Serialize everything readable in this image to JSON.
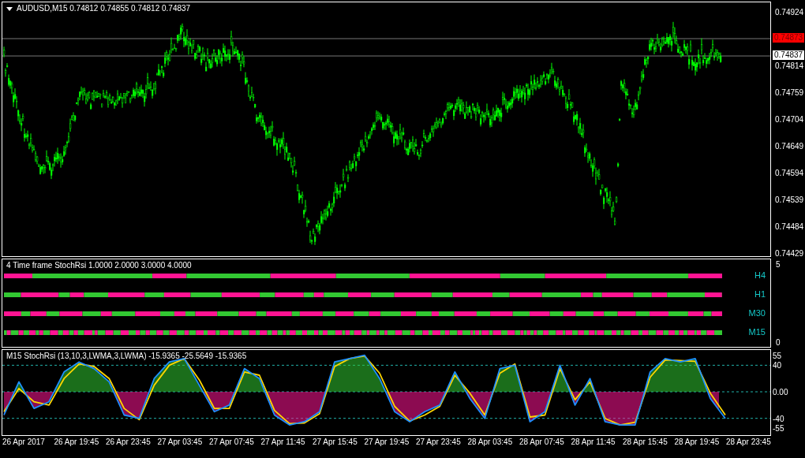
{
  "main_chart": {
    "title": "AUDUSD,M15  0.74812 0.74855 0.74812 0.74837",
    "price_axis": [
      {
        "kind": "tick",
        "label": "0.74924"
      },
      {
        "kind": "ask",
        "label": "0.74873"
      },
      {
        "kind": "bid",
        "label": "0.74837"
      },
      {
        "kind": "tick",
        "label": "0.74814"
      },
      {
        "kind": "tick",
        "label": "0.74759"
      },
      {
        "kind": "tick",
        "label": "0.74704"
      },
      {
        "kind": "tick",
        "label": "0.74649"
      },
      {
        "kind": "tick",
        "label": "0.74594"
      },
      {
        "kind": "tick",
        "label": "0.74539"
      },
      {
        "kind": "tick",
        "label": "0.74484"
      },
      {
        "kind": "tick",
        "label": "0.74429"
      }
    ]
  },
  "timeframe_panel": {
    "title": "4 Time frame StochRsi 1.0000 2.0000 3.0000 4.0000",
    "rows": [
      {
        "label": "H4"
      },
      {
        "label": "H1"
      },
      {
        "label": "M30"
      },
      {
        "label": "M15"
      }
    ],
    "axis": [
      "5",
      "0"
    ]
  },
  "oscillator_panel": {
    "title": "M15  StochRsi (13,10,3,LWMA,3,LWMA) -15.9365 -25.5649 -15.9365",
    "chart_data": {
      "type": "line",
      "ylim": [
        -66.5,
        63
      ],
      "grid": true,
      "yticks": [
        {
          "value": 55,
          "label": "55"
        },
        {
          "value": 40,
          "label": "40"
        },
        {
          "value": 0,
          "label": "0.00"
        },
        {
          "value": -40,
          "label": "-40"
        },
        {
          "value": -55,
          "label": "-55"
        }
      ],
      "series": [
        {
          "color": "#1e90ff",
          "values": [
            -35,
            15,
            -25,
            -15,
            30,
            45,
            35,
            15,
            -35,
            -40,
            20,
            45,
            50,
            10,
            -30,
            -20,
            35,
            20,
            -35,
            -50,
            -45,
            -30,
            45,
            50,
            55,
            20,
            -30,
            -45,
            -30,
            -20,
            30,
            -10,
            -40,
            35,
            40,
            -45,
            -30,
            40,
            -20,
            20,
            -45,
            -50,
            -50,
            30,
            50,
            45,
            50,
            -10,
            -40
          ]
        },
        {
          "color": "#ffd700",
          "values": [
            -30,
            5,
            -15,
            -20,
            20,
            42,
            38,
            20,
            -25,
            -42,
            10,
            40,
            50,
            18,
            -25,
            -25,
            30,
            25,
            -28,
            -48,
            -47,
            -33,
            38,
            50,
            54,
            28,
            -22,
            -44,
            -35,
            -22,
            25,
            -2,
            -35,
            28,
            42,
            -38,
            -35,
            35,
            -12,
            15,
            -40,
            -50,
            -46,
            22,
            48,
            47,
            46,
            -2,
            -35
          ]
        }
      ]
    }
  },
  "time_axis": [
    "26 Apr 2017",
    "26 Apr 19:45",
    "26 Apr 23:45",
    "27 Apr 03:45",
    "27 Apr 07:45",
    "27 Apr 11:45",
    "27 Apr 15:45",
    "27 Apr 19:45",
    "27 Apr 23:45",
    "28 Apr 03:45",
    "28 Apr 07:45",
    "28 Apr 11:45",
    "28 Apr 15:45",
    "28 Apr 19:45",
    "28 Apr 23:45"
  ]
}
